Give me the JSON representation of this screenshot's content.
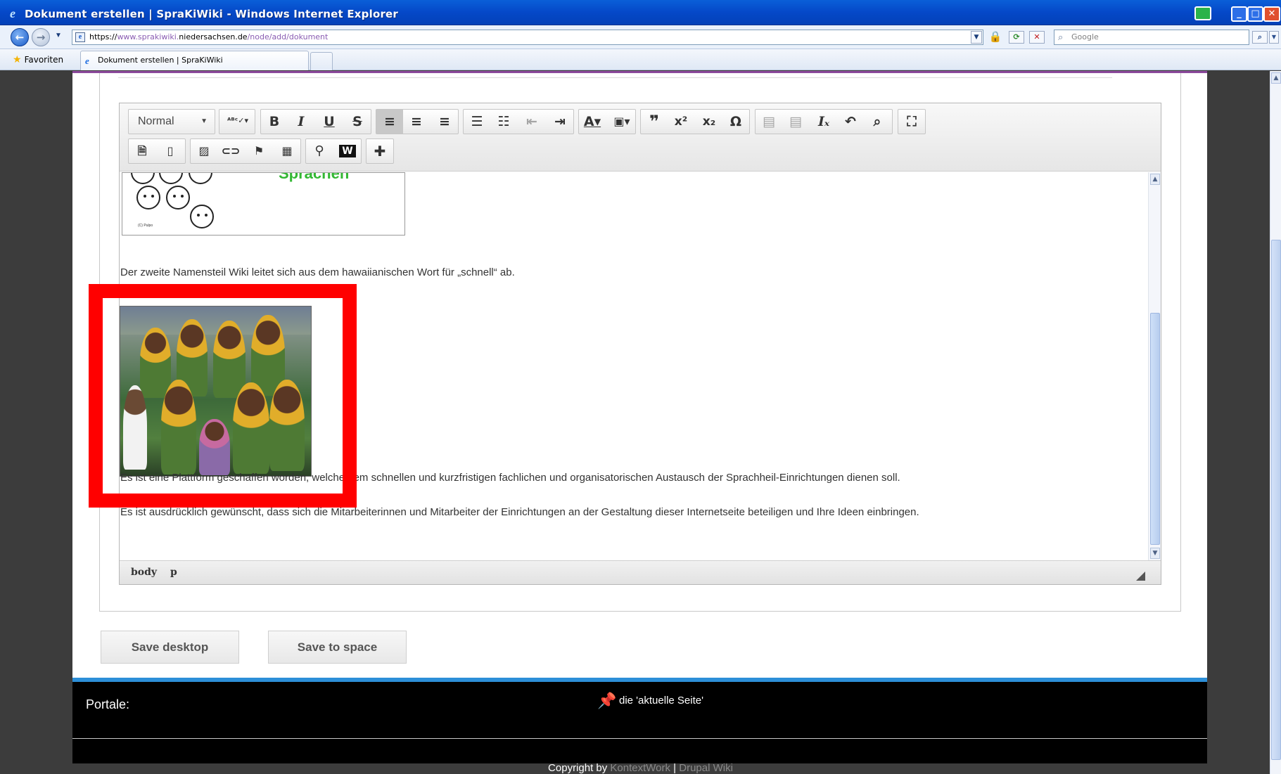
{
  "window": {
    "title": "Dokument erstellen | SpraKiWiki - Windows Internet Explorer",
    "min": "_",
    "max": "□",
    "close": "✕"
  },
  "addressbar": {
    "url_prefix": "https://",
    "url_host_sub": "www.sprakiwiki.",
    "url_host_main": "niedersachsen.de",
    "url_path": "/node/add/dokument",
    "search_placeholder": "Google"
  },
  "tabs": {
    "favorites_label": "Favoriten",
    "active_tab_title": "Dokument erstellen | SpraKiWiki"
  },
  "editor": {
    "format_value": "Normal",
    "toolbar_row1": [
      {
        "name": "spellcheck-button",
        "glyph": "ᴬᴮᶜ",
        "group": 1
      },
      {
        "name": "bold-button",
        "glyph": "B"
      },
      {
        "name": "italic-button",
        "glyph": "I"
      },
      {
        "name": "underline-button",
        "glyph": "U"
      },
      {
        "name": "strikethrough-button",
        "glyph": "S"
      },
      {
        "name": "align-left-button",
        "glyph": "≡"
      },
      {
        "name": "align-center-button",
        "glyph": "≡"
      },
      {
        "name": "align-right-button",
        "glyph": "≡"
      },
      {
        "name": "bulleted-list-button",
        "glyph": "☰"
      },
      {
        "name": "numbered-list-button",
        "glyph": "☰"
      },
      {
        "name": "outdent-button",
        "glyph": "⇤"
      },
      {
        "name": "indent-button",
        "glyph": "⇥"
      },
      {
        "name": "text-color-button",
        "glyph": "A"
      },
      {
        "name": "background-color-button",
        "glyph": "A"
      },
      {
        "name": "blockquote-button",
        "glyph": "❞"
      },
      {
        "name": "superscript-button",
        "glyph": "x²"
      },
      {
        "name": "subscript-button",
        "glyph": "x₂"
      },
      {
        "name": "special-char-button",
        "glyph": "Ω"
      },
      {
        "name": "paste-button",
        "glyph": "▤"
      },
      {
        "name": "paste-text-button",
        "glyph": "▤"
      },
      {
        "name": "remove-format-button",
        "glyph": "Iₓ"
      },
      {
        "name": "undo-button",
        "glyph": "↶"
      },
      {
        "name": "find-button",
        "glyph": "⌕"
      },
      {
        "name": "maximize-button",
        "glyph": "⛶"
      }
    ],
    "paragraphs": {
      "p1": "Der zweite Namensteil Wiki leitet sich aus dem hawaiianischen Wort für „schnell“ ab.",
      "p2": "Es ist eine Plattform geschaffen worden, welche dem schnellen und kurzfristigen fachlichen und organisatorischen Austausch der Sprachheil-Einrichtungen dienen soll.",
      "p3": "Es ist ausdrücklich gewünscht, dass sich die Mitarbeiterinnen und Mitarbeiter der Einrichtungen an der Gestaltung dieser Internetseite beteiligen und Ihre Ideen einbringen."
    },
    "top_image_caption": "Sprachen",
    "top_image_credit": "(C) Pulpo",
    "path": [
      "body",
      "p"
    ]
  },
  "buttons": {
    "save_desktop": "Save desktop",
    "save_to_space": "Save to space"
  },
  "footer": {
    "portale": "Portale:",
    "aktuelle": "die 'aktuelle Seite'",
    "copyright_prefix": "Copyright by ",
    "link1": "KontextWork",
    "sep": " | ",
    "link2": "Drupal Wiki"
  },
  "colors": {
    "highlight": "#ff0000",
    "titlebar": "#0548c8",
    "footer_accent": "#2d8fd8",
    "page_accent": "#8c4a9c"
  }
}
